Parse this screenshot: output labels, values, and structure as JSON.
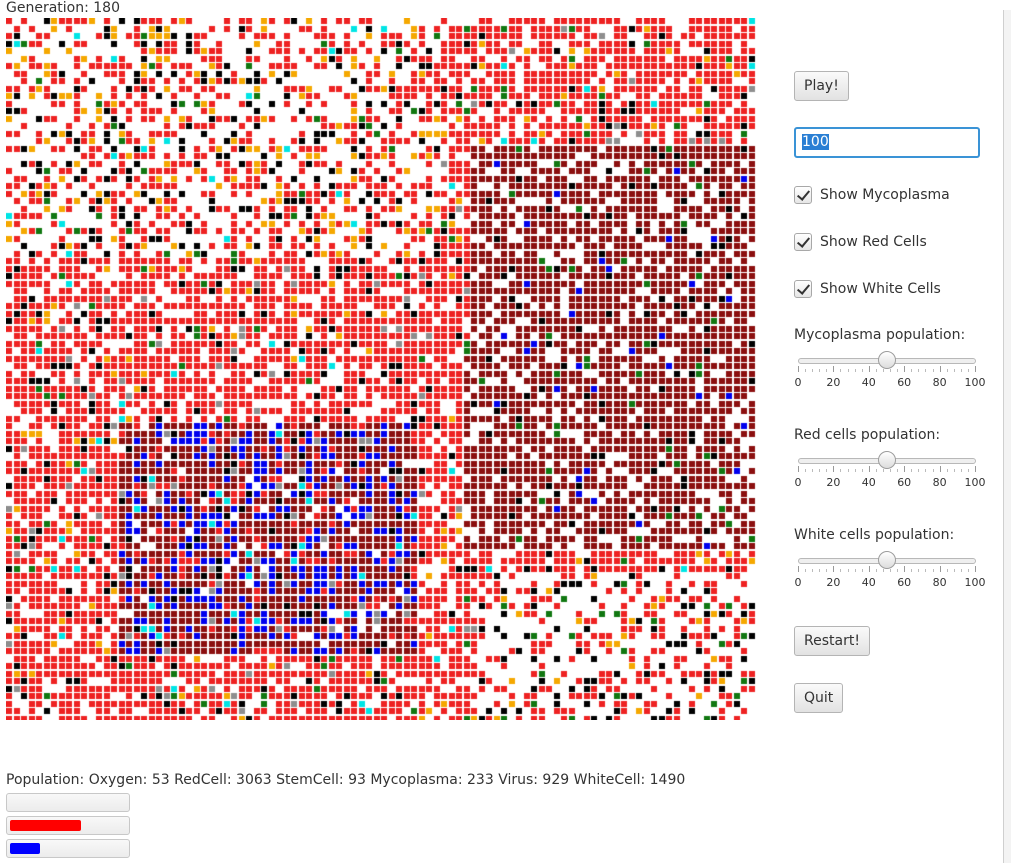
{
  "header": {
    "generation_label": "Generation: 180"
  },
  "controls": {
    "play_label": "Play!",
    "speed_input_value": "100",
    "checkboxes": [
      {
        "label": "Show Mycoplasma",
        "checked": true
      },
      {
        "label": "Show Red Cells",
        "checked": true
      },
      {
        "label": "Show White Cells",
        "checked": true
      }
    ],
    "sliders": [
      {
        "label": "Mycoplasma population:",
        "value": 50,
        "min": 0,
        "max": 100,
        "ticks": [
          "0",
          "20",
          "40",
          "60",
          "80",
          "100"
        ]
      },
      {
        "label": "Red cells population:",
        "value": 50,
        "min": 0,
        "max": 100,
        "ticks": [
          "0",
          "20",
          "40",
          "60",
          "80",
          "100"
        ]
      },
      {
        "label": "White cells population:",
        "value": 50,
        "min": 0,
        "max": 100,
        "ticks": [
          "0",
          "20",
          "40",
          "60",
          "80",
          "100"
        ]
      }
    ],
    "restart_label": "Restart!",
    "quit_label": "Quit"
  },
  "status": {
    "population_text": "Population: Oxygen: 53 RedCell: 3063 StemCell: 93 Mycoplasma: 233 Virus: 929 WhiteCell: 1490"
  },
  "progress_bars": [
    {
      "fill": 0.0,
      "color": "#ff0000"
    },
    {
      "fill": 0.6,
      "color": "#ff0000"
    },
    {
      "fill": 0.25,
      "color": "#0000ff"
    }
  ],
  "colors": {
    "red_cell": "#ee2222",
    "dark_red": "#8b0f0f",
    "white_cell": "#0a0aa8",
    "black": "#000000",
    "orange": "#f5a800",
    "green": "#117711",
    "cyan": "#00e5e5",
    "gray": "#8e8e8e",
    "blue": "#0000ee",
    "empty": "#ffffff",
    "accent": "#3a93d6"
  }
}
